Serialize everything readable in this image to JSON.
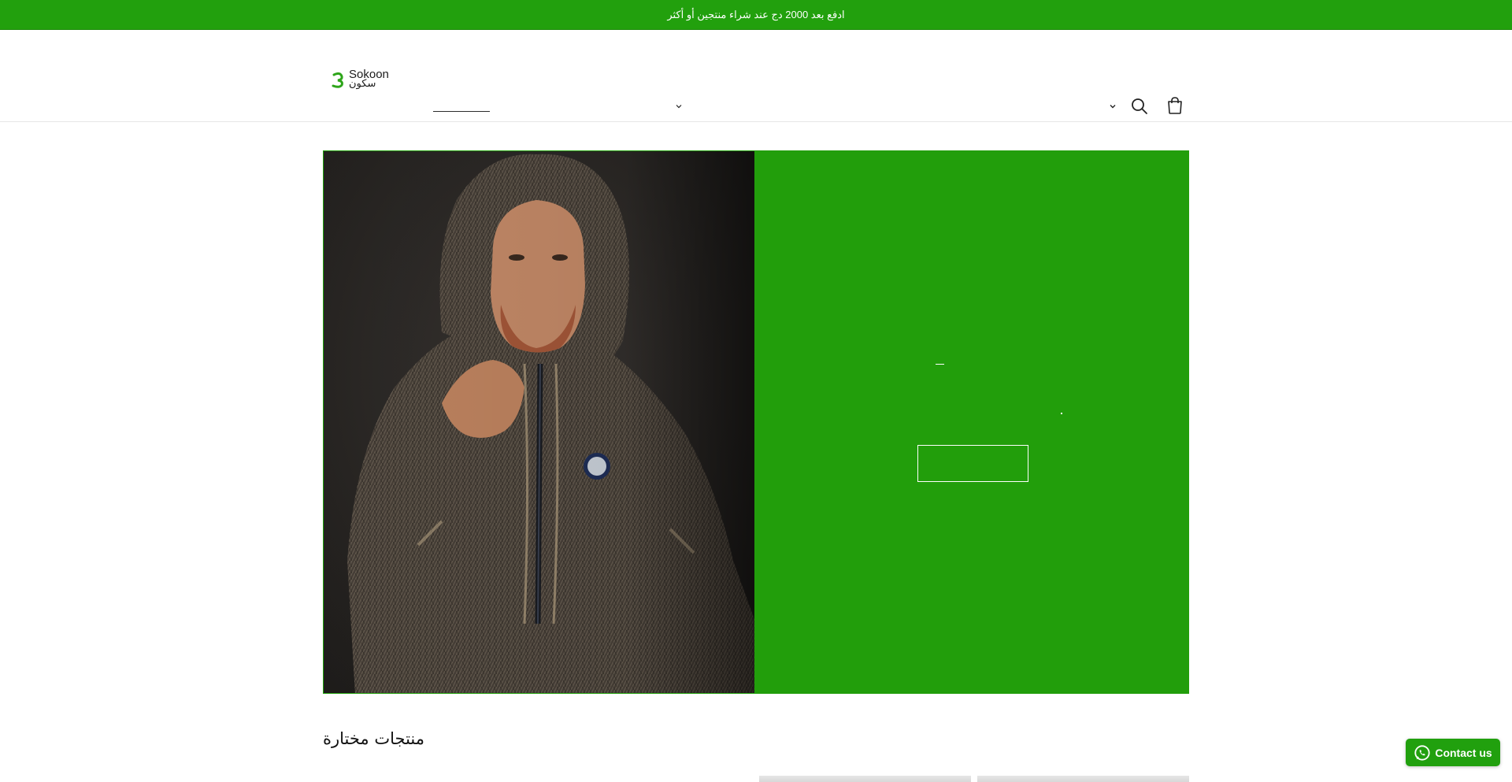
{
  "announcement": {
    "text": "ادفع بعد 2000 دج عند شراء منتجين أو أكثر"
  },
  "header": {
    "logo": {
      "text_en": "Sokoon",
      "text_ar": "سكون"
    },
    "icons": {
      "nav_chevron": "chevron-down-icon",
      "lang_chevron": "chevron-down-icon",
      "search": "search-icon",
      "cart": "cart-icon"
    }
  },
  "hero": {
    "image_subject": "man in hooded brown herringbone djellaba",
    "panel_color": "#229e0b",
    "button_label": ""
  },
  "featured": {
    "heading": "منتجات مختارة"
  },
  "contact": {
    "label": "Contact us",
    "icon": "whatsapp-icon"
  },
  "colors": {
    "brand_green": "#22a00d",
    "white": "#ffffff"
  }
}
